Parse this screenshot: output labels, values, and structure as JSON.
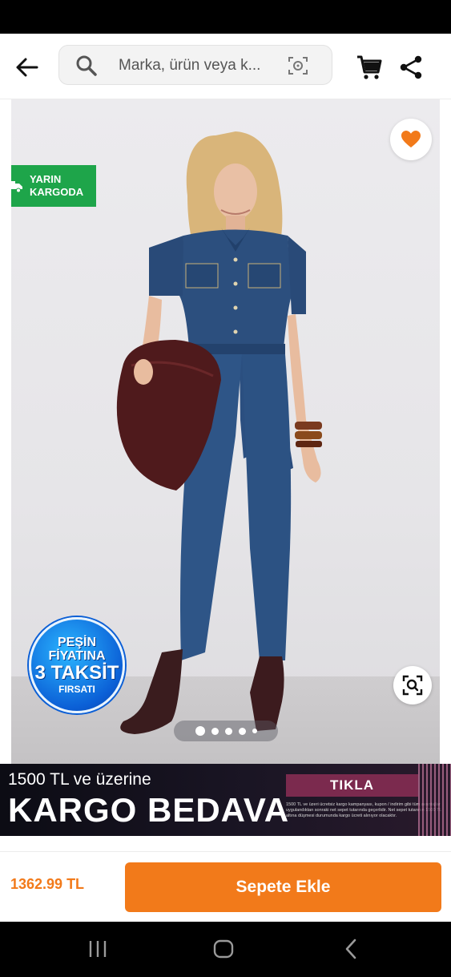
{
  "search": {
    "placeholder": "Marka, ürün veya k..."
  },
  "icons": {
    "back": "arrow-left-icon",
    "search": "search-icon",
    "camera": "camera-search-icon",
    "cart": "cart-icon",
    "share": "share-icon",
    "favorite": "heart-icon",
    "zoom": "zoom-scan-icon",
    "truck": "truck-icon"
  },
  "gallery": {
    "cargo_badge": [
      "YARIN",
      "KARGODA"
    ],
    "installment_badge": {
      "line1": "PEŞİN",
      "line2": "FİYATINA",
      "line3": "3 TAKSİT",
      "line4": "FIRSATI"
    },
    "pager": {
      "count": 5,
      "active_index": 0
    }
  },
  "promo": {
    "line1": "1500 TL ve üzerine",
    "line2": "KARGO BEDAVA",
    "cta": "TIKLA",
    "fine_print": "1500 TL ve üzeri ücretsiz kargo kampanyası, kupon / indirim gibi tüm avantajlar uygulandıktan sonraki net sepet tutarında geçerlidir. Net sepet tutarının 1500 TL altına düşmesi durumunda kargo ücreti alınıyor olacaktır."
  },
  "footer": {
    "price": "1362.99 TL",
    "add_to_cart": "Sepete Ekle"
  },
  "colors": {
    "accent": "#f27a1a",
    "cargo_green": "#1ea54a",
    "promo_cta": "#7b2a4e"
  }
}
